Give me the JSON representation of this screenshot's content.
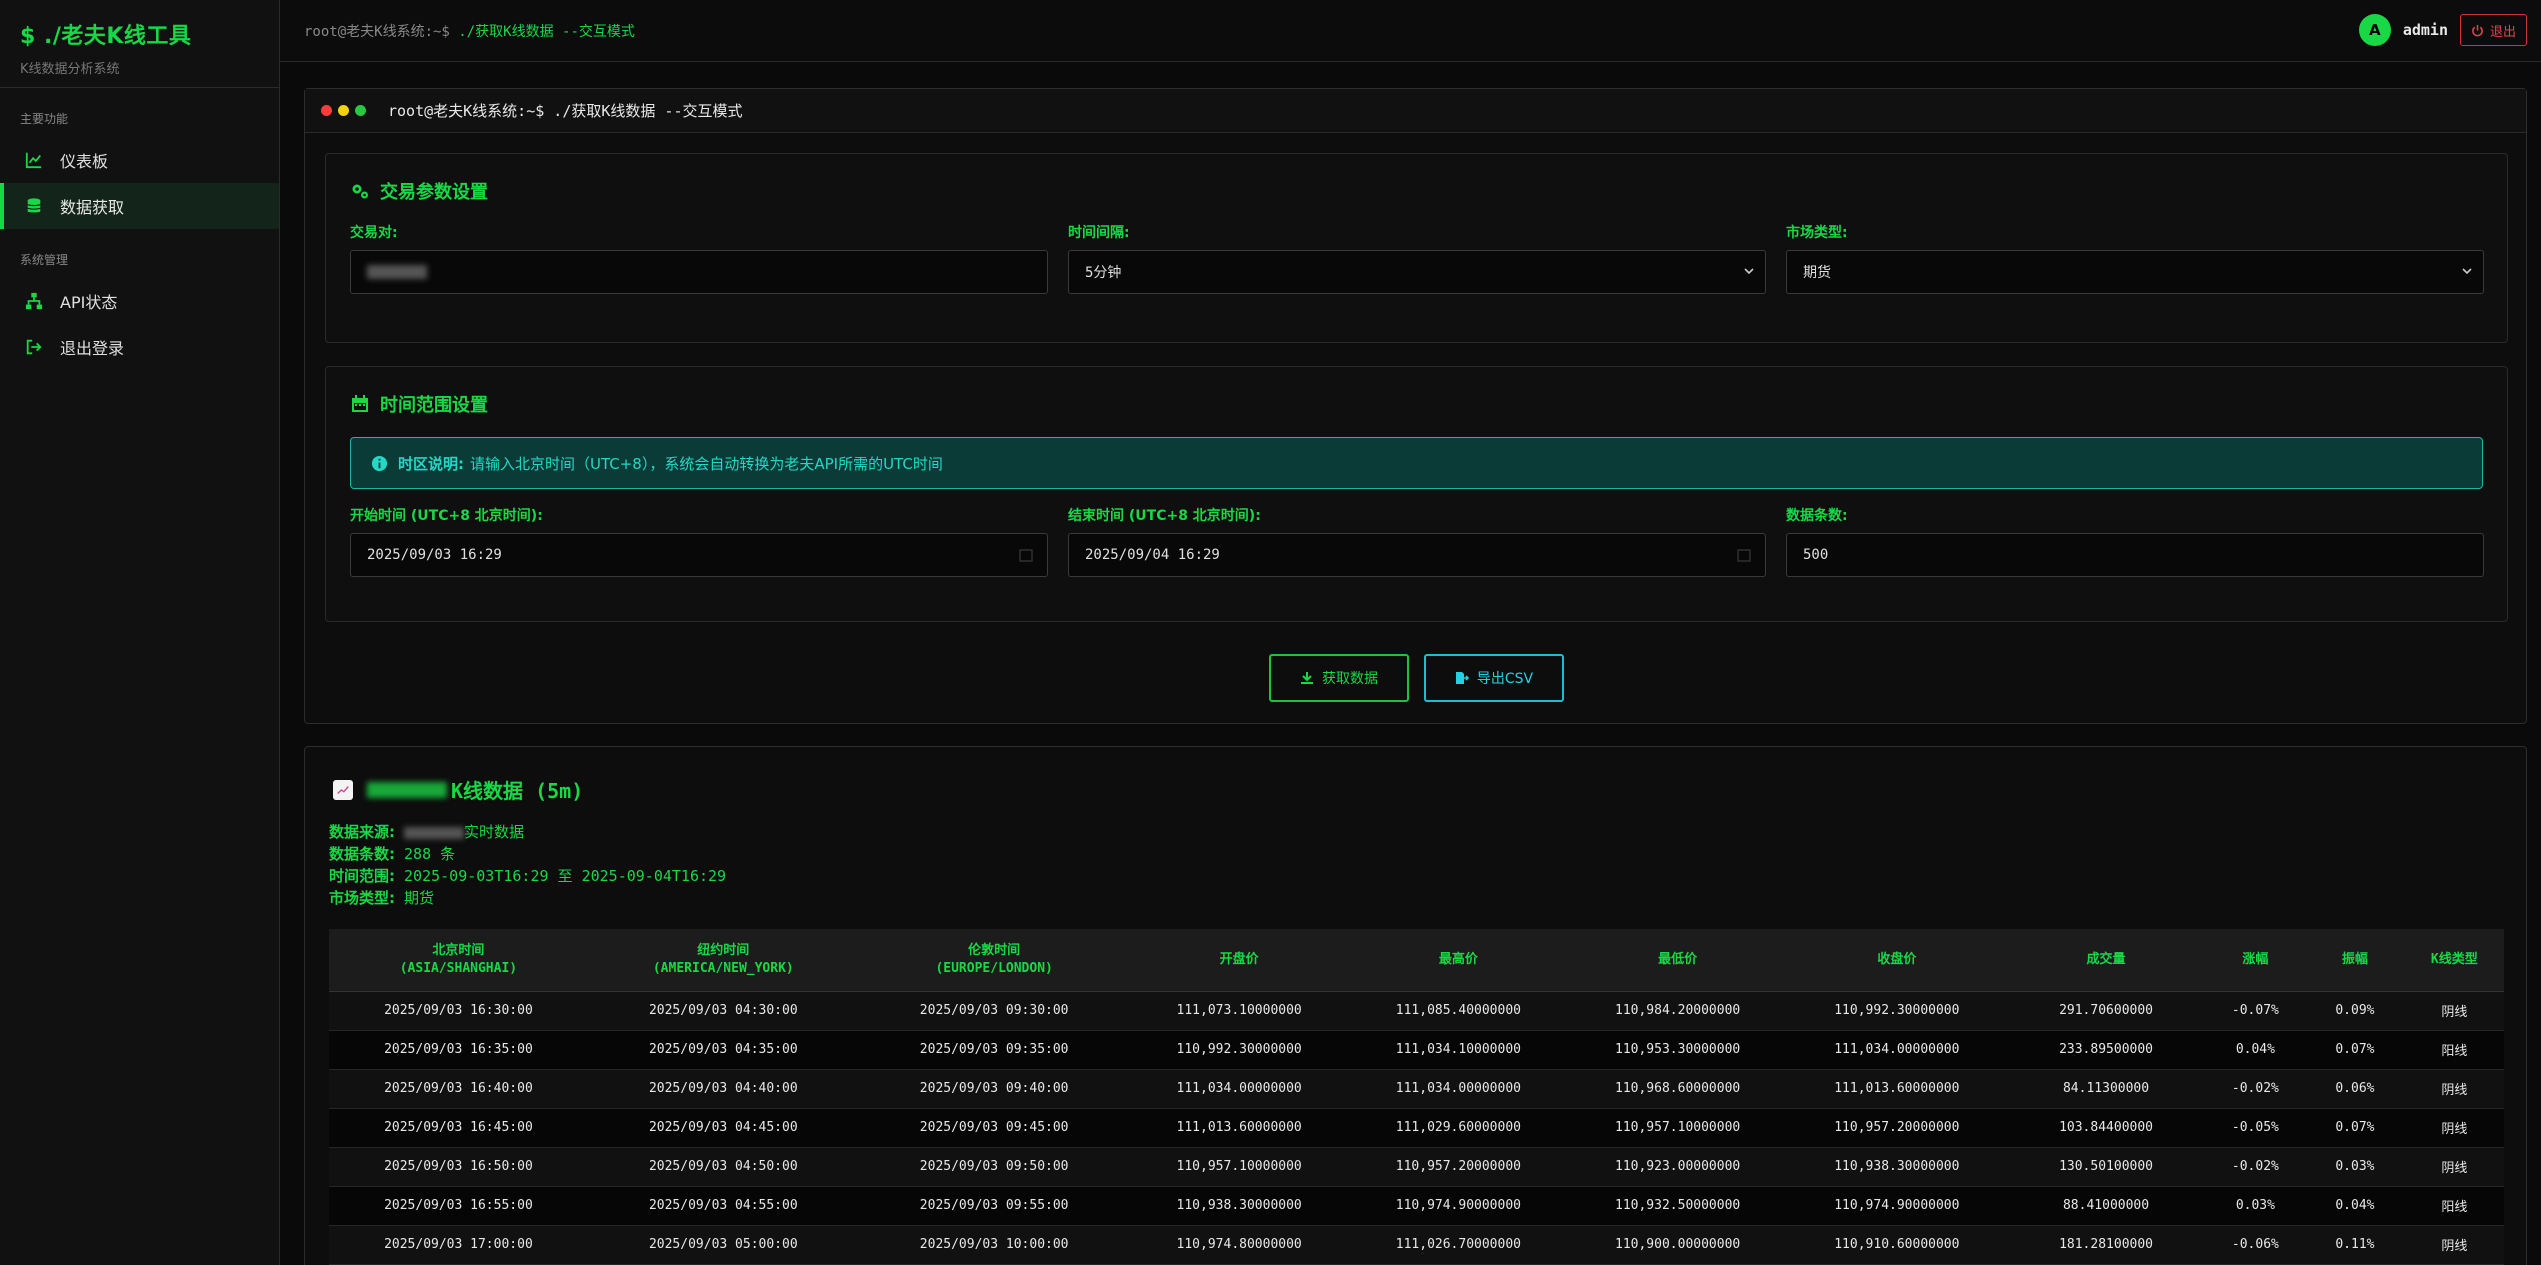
{
  "sidebar": {
    "brand_title": "$ ./老夫K线工具",
    "brand_subtitle": "K线数据分析系统",
    "section_main": "主要功能",
    "section_system": "系统管理",
    "items": [
      {
        "label": "仪表板",
        "icon": "chart-line-icon"
      },
      {
        "label": "数据获取",
        "icon": "database-icon",
        "active": true
      },
      {
        "label": "API状态",
        "icon": "sitemap-icon"
      },
      {
        "label": "退出登录",
        "icon": "sign-out-icon"
      }
    ]
  },
  "topbar": {
    "prompt": "root@老夫K线系统:~$",
    "command": "./获取K线数据 --交互模式",
    "avatar_letter": "A",
    "username": "admin",
    "logout_label": "退出"
  },
  "terminal": {
    "title": "root@老夫K线系统:~$ ./获取K线数据 --交互模式",
    "dots": [
      "#ff3b3b",
      "#f4d20a",
      "#28c840"
    ]
  },
  "trade_settings": {
    "title": "交易参数设置",
    "pair_label": "交易对:",
    "interval_label": "时间间隔:",
    "interval_value": "5分钟",
    "market_label": "市场类型:",
    "market_value": "期货"
  },
  "time_settings": {
    "title": "时间范围设置",
    "notice_bold": "时区说明:",
    "notice_text": "请输入北京时间（UTC+8），系统会自动转换为老夫API所需的UTC时间",
    "start_label": "开始时间 (UTC+8 北京时间):",
    "start_value": "2025/09/03 16:29",
    "end_label": "结束时间 (UTC+8 北京时间):",
    "end_value": "2025/09/04 16:29",
    "count_label": "数据条数:",
    "count_value": "500"
  },
  "actions": {
    "fetch_label": "获取数据",
    "export_label": "导出CSV"
  },
  "results": {
    "title_suffix": "K线数据 (5m)",
    "source_label": "数据来源:",
    "source_value": "实时数据",
    "count_label": "数据条数:",
    "count_value": "288 条",
    "range_label": "时间范围:",
    "range_value": "2025-09-03T16:29 至 2025-09-04T16:29",
    "market_label": "市场类型:",
    "market_value": "期货",
    "columns": [
      [
        "北京时间",
        "(ASIA/SHANGHAI)"
      ],
      [
        "纽约时间",
        "(AMERICA/NEW_YORK)"
      ],
      [
        "伦敦时间",
        "(EUROPE/LONDON)"
      ],
      [
        "开盘价",
        ""
      ],
      [
        "最高价",
        ""
      ],
      [
        "最低价",
        ""
      ],
      [
        "收盘价",
        ""
      ],
      [
        "成交量",
        ""
      ],
      [
        "涨幅",
        ""
      ],
      [
        "振幅",
        ""
      ],
      [
        "K线类型",
        ""
      ]
    ],
    "rows": [
      [
        "2025/09/03 16:30:00",
        "2025/09/03 04:30:00",
        "2025/09/03 09:30:00",
        "111,073.10000000",
        "111,085.40000000",
        "110,984.20000000",
        "110,992.30000000",
        "291.70600000",
        "-0.07%",
        "0.09%",
        "阴线"
      ],
      [
        "2025/09/03 16:35:00",
        "2025/09/03 04:35:00",
        "2025/09/03 09:35:00",
        "110,992.30000000",
        "111,034.10000000",
        "110,953.30000000",
        "111,034.00000000",
        "233.89500000",
        "0.04%",
        "0.07%",
        "阳线"
      ],
      [
        "2025/09/03 16:40:00",
        "2025/09/03 04:40:00",
        "2025/09/03 09:40:00",
        "111,034.00000000",
        "111,034.00000000",
        "110,968.60000000",
        "111,013.60000000",
        "84.11300000",
        "-0.02%",
        "0.06%",
        "阴线"
      ],
      [
        "2025/09/03 16:45:00",
        "2025/09/03 04:45:00",
        "2025/09/03 09:45:00",
        "111,013.60000000",
        "111,029.60000000",
        "110,957.10000000",
        "110,957.20000000",
        "103.84400000",
        "-0.05%",
        "0.07%",
        "阴线"
      ],
      [
        "2025/09/03 16:50:00",
        "2025/09/03 04:50:00",
        "2025/09/03 09:50:00",
        "110,957.10000000",
        "110,957.20000000",
        "110,923.00000000",
        "110,938.30000000",
        "130.50100000",
        "-0.02%",
        "0.03%",
        "阴线"
      ],
      [
        "2025/09/03 16:55:00",
        "2025/09/03 04:55:00",
        "2025/09/03 09:55:00",
        "110,938.30000000",
        "110,974.90000000",
        "110,932.50000000",
        "110,974.90000000",
        "88.41000000",
        "0.03%",
        "0.04%",
        "阳线"
      ],
      [
        "2025/09/03 17:00:00",
        "2025/09/03 05:00:00",
        "2025/09/03 10:00:00",
        "110,974.80000000",
        "111,026.70000000",
        "110,900.00000000",
        "110,910.60000000",
        "181.28100000",
        "-0.06%",
        "0.11%",
        "阴线"
      ]
    ]
  },
  "colors": {
    "accent": "#18d846",
    "info": "#22d8c6",
    "danger": "#e0444e",
    "background": "#0a0a0a"
  }
}
